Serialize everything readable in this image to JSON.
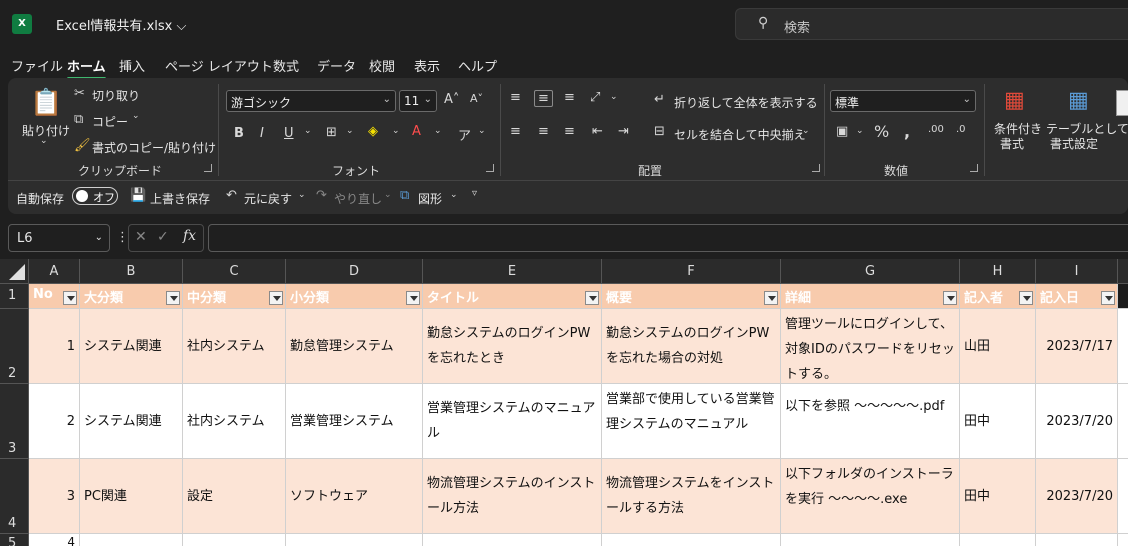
{
  "titlebar": {
    "logo": "X",
    "filename": "Excel情報共有.xlsx ⌵",
    "search_placeholder": "検索",
    "search_icon": "search-icon"
  },
  "menu": [
    "ファイル",
    "ホーム",
    "挿入",
    "ページ レイアウト",
    "数式",
    "データ",
    "校閲",
    "表示",
    "ヘルプ"
  ],
  "ribbon": {
    "clipboard": {
      "paste": "貼り付け",
      "cut": "切り取り",
      "copy": "コピー",
      "format_painter": "書式のコピー/貼り付け",
      "label": "クリップボード"
    },
    "font": {
      "name": "游ゴシック",
      "size": "11",
      "label": "フォント"
    },
    "alignment": {
      "wrap": "折り返して全体を表示する",
      "merge": "セルを結合して中央揃え",
      "label": "配置"
    },
    "number": {
      "format": "標準",
      "label": "数値"
    },
    "styles": {
      "conditional_line1": "条件付き",
      "conditional_line2": "書式",
      "table_line1": "テーブルとして",
      "table_line2": "書式設定"
    }
  },
  "qat": {
    "autosave": "自動保存",
    "toggle": "オフ",
    "save": "上書き保存",
    "undo": "元に戻す",
    "redo": "やり直し",
    "shapes": "図形"
  },
  "formula_bar": {
    "name_box": "L6",
    "fx": "fx"
  },
  "columns": [
    "A",
    "B",
    "C",
    "D",
    "E",
    "F",
    "G",
    "H",
    "I"
  ],
  "rows": [
    "1",
    "2",
    "3",
    "4",
    "5"
  ],
  "table": {
    "headers": [
      "No",
      "大分類",
      "中分類",
      "小分類",
      "タイトル",
      "概要",
      "詳細",
      "記入者",
      "記入日"
    ],
    "rows": [
      {
        "no": "1",
        "l1": "システム関連",
        "l2": "社内システム",
        "l3": "勤怠管理システム",
        "title": "勤怠システムのログインPWを忘れたとき",
        "summary": "勤怠システムのログインPWを忘れた場合の対処",
        "detail": "管理ツールにログインして、対象IDのパスワードをリセットする。",
        "author": "山田",
        "date": "2023/7/17"
      },
      {
        "no": "2",
        "l1": "システム関連",
        "l2": "社内システム",
        "l3": "営業管理システム",
        "title": "営業管理システムのマニュアル",
        "summary": "営業部で使用している営業管理システムのマニュアル",
        "detail": "以下を参照 〜〜〜〜〜.pdf",
        "author": "田中",
        "date": "2023/7/20"
      },
      {
        "no": "3",
        "l1": "PC関連",
        "l2": "設定",
        "l3": "ソフトウェア",
        "title": "物流管理システムのインストール方法",
        "summary": "物流管理システムをインストールする方法",
        "detail": "以下フォルダのインストーラを実行 〜〜〜〜.exe",
        "author": "田中",
        "date": "2023/7/20"
      }
    ],
    "row5_no": "4"
  }
}
